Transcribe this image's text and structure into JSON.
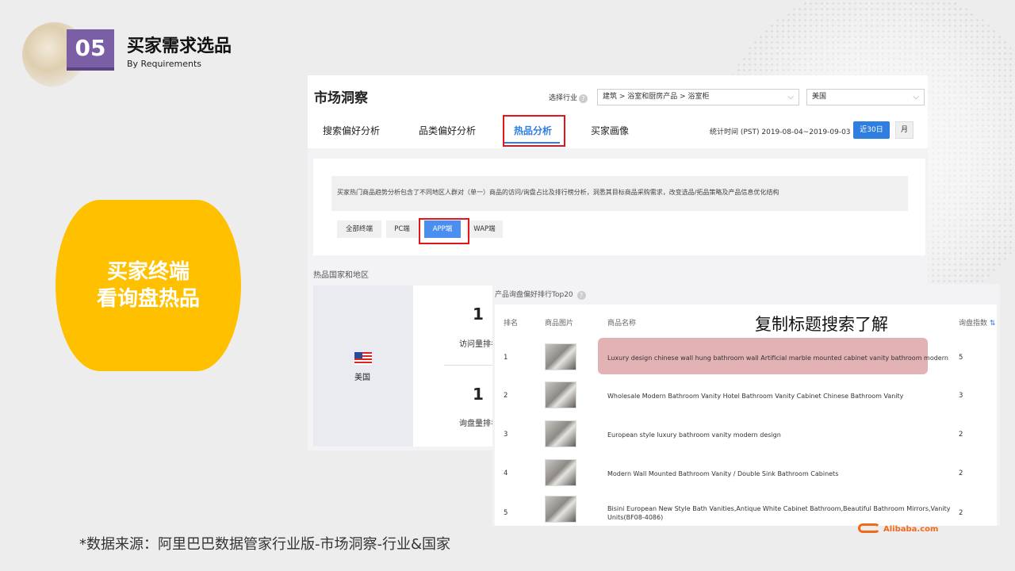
{
  "slide": {
    "number": "05",
    "title": "买家需求选品",
    "subtitle": "By Requirements",
    "pill_line1": "买家终端",
    "pill_line2": "看询盘热品",
    "source": "*数据来源：阿里巴巴数据管家行业版-市场洞察-行业&国家",
    "logo_text": "Alibaba.com",
    "brand_color": "#7b5fa6",
    "pill_color": "#ffc000"
  },
  "market": {
    "title": "市场洞察",
    "industry_label": "选择行业",
    "industry_value": "建筑 > 浴室和厨房产品 > 浴室柜",
    "country_value": "美国",
    "tabs": [
      "搜索偏好分析",
      "品类偏好分析",
      "热品分析",
      "买家画像"
    ],
    "active_tab": "热品分析",
    "stat_time": "统计时间 (PST) 2019-08-04~2019-09-03",
    "btn_30": "近30日",
    "btn_month": "月",
    "description": "买家热门商品趋势分析包含了不同地区人群对（单一）商品的访问/询盘占比及排行榜分析，洞悉其目标商品采购需求，改变选品/拓品策略及产品信息优化结构",
    "segments": [
      "全部终端",
      "PC端",
      "APP端",
      "WAP端"
    ],
    "active_segment": "APP端",
    "hot_region_label": "热品国家和地区",
    "country": "美国",
    "visit_rank_value": "1",
    "visit_rank_label": "访问量排名",
    "inquiry_rank_value": "1",
    "inquiry_rank_label": "询盘量排名",
    "accent": "#2f7ee0"
  },
  "top20": {
    "title": "产品询盘偏好排行Top20",
    "copy_tip": "复制标题搜索了解",
    "headers": {
      "rank": "排名",
      "image": "商品图片",
      "name": "商品名称",
      "index": "询盘指数"
    },
    "rows": [
      {
        "rank": "1",
        "name": "Luxury design chinese wall hung bathroom wall Artificial marble mounted cabinet vanity bathroom modern",
        "index": "5"
      },
      {
        "rank": "2",
        "name": "Wholesale Modern Bathroom Vanity Hotel Bathroom Vanity Cabinet Chinese Bathroom Vanity",
        "index": "3"
      },
      {
        "rank": "3",
        "name": "European style luxury bathroom vanity modern design",
        "index": "2"
      },
      {
        "rank": "4",
        "name": "Modern Wall Mounted Bathroom Vanity / Double Sink Bathroom Cabinets",
        "index": "2"
      },
      {
        "rank": "5",
        "name": "Bisini European New Style Bath Vanities,Antique White Cabinet Bathroom,Beautiful Bathroom Mirrors,Vanity Units(BF08-4086)",
        "index": "2"
      }
    ]
  }
}
